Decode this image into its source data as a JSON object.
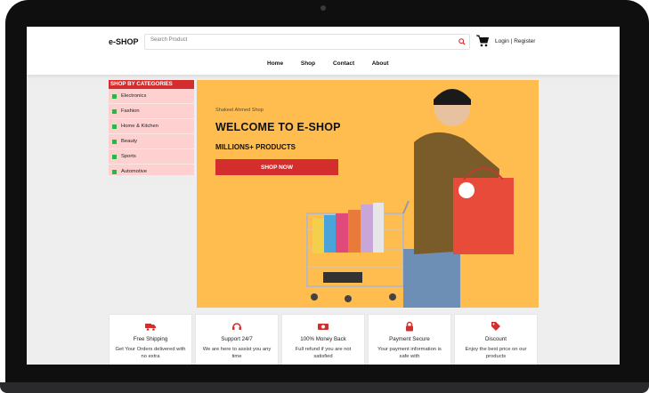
{
  "header": {
    "logo": "e-SHOP",
    "search_placeholder": "Search Product",
    "auth_text": "Login | Register"
  },
  "nav": [
    "Home",
    "Shop",
    "Contact",
    "About"
  ],
  "sidebar": {
    "title": "SHOP BY CATEGORIES",
    "items": [
      "Electronics",
      "Fashion",
      "Home & Kitchen",
      "Beauty",
      "Sports",
      "Automotive"
    ]
  },
  "hero": {
    "small_text": "Shakeel Ahmed Shop",
    "title": "WELCOME TO E-SHOP",
    "subtitle": "MILLIONS+ PRODUCTS",
    "button_label": "SHOP NOW"
  },
  "features": [
    {
      "icon": "truck-icon",
      "title": "Free Shipping",
      "desc": "Get Your Orders delivered with no extra"
    },
    {
      "icon": "headset-icon",
      "title": "Support 24/7",
      "desc": "We are here to assist you any time"
    },
    {
      "icon": "money-icon",
      "title": "100% Money Back",
      "desc": "Full refund if you are not satisfied"
    },
    {
      "icon": "lock-icon",
      "title": "Payment Secure",
      "desc": "Your payment information is safe with"
    },
    {
      "icon": "tag-icon",
      "title": "Discount",
      "desc": "Enjoy the best price on our products"
    }
  ],
  "colors": {
    "accent": "#d42d2d",
    "hero_bg": "#ffbd4f",
    "category_bg": "#ffd0d0",
    "bullet": "#2fb44a"
  }
}
